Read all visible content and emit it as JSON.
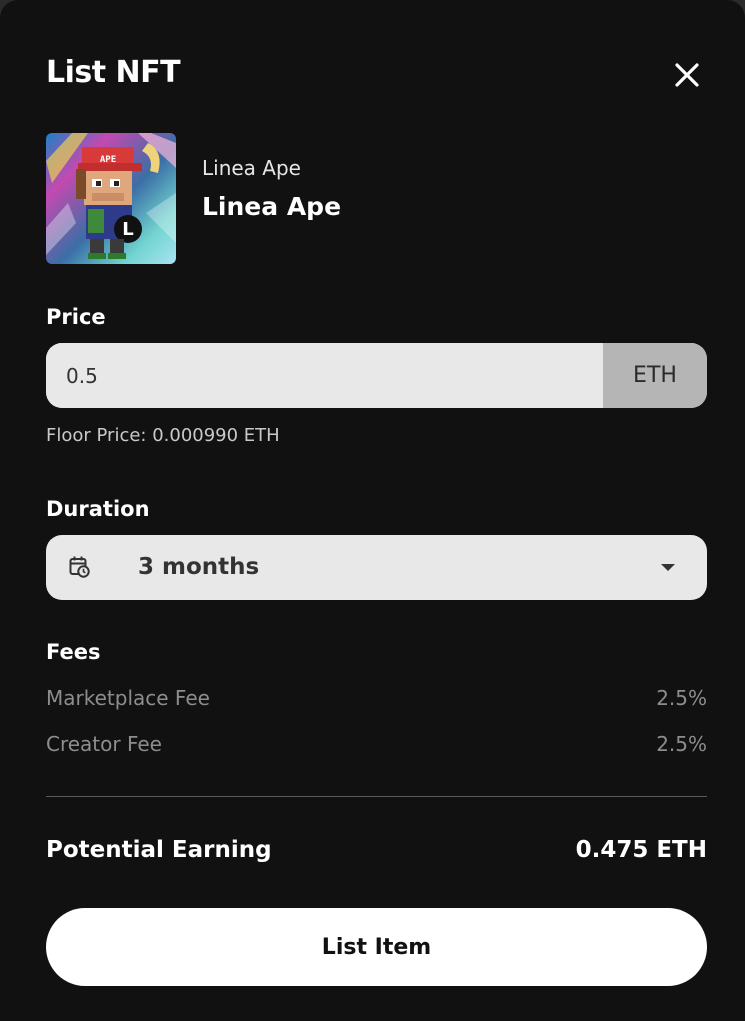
{
  "modal": {
    "title": "List NFT",
    "close_icon": "close-icon"
  },
  "nft": {
    "collection": "Linea Ape",
    "name": "Linea Ape",
    "image_badge": "APE"
  },
  "price": {
    "label": "Price",
    "value": "0.5",
    "unit": "ETH",
    "floor_price_text": "Floor Price: 0.000990 ETH"
  },
  "duration": {
    "label": "Duration",
    "value": "3 months",
    "icon": "calendar-clock-icon",
    "caret_icon": "caret-down-icon"
  },
  "fees": {
    "label": "Fees",
    "items": [
      {
        "label": "Marketplace Fee",
        "value": "2.5%"
      },
      {
        "label": "Creator Fee",
        "value": "2.5%"
      }
    ]
  },
  "earning": {
    "label": "Potential Earning",
    "value": "0.475 ETH"
  },
  "actions": {
    "list_button": "List Item"
  },
  "colors": {
    "modal_background": "#111112",
    "input_background": "#e8e8e8",
    "unit_background": "#b5b5b5",
    "muted_text": "#8d8d8d",
    "button_background": "#ffffff"
  }
}
